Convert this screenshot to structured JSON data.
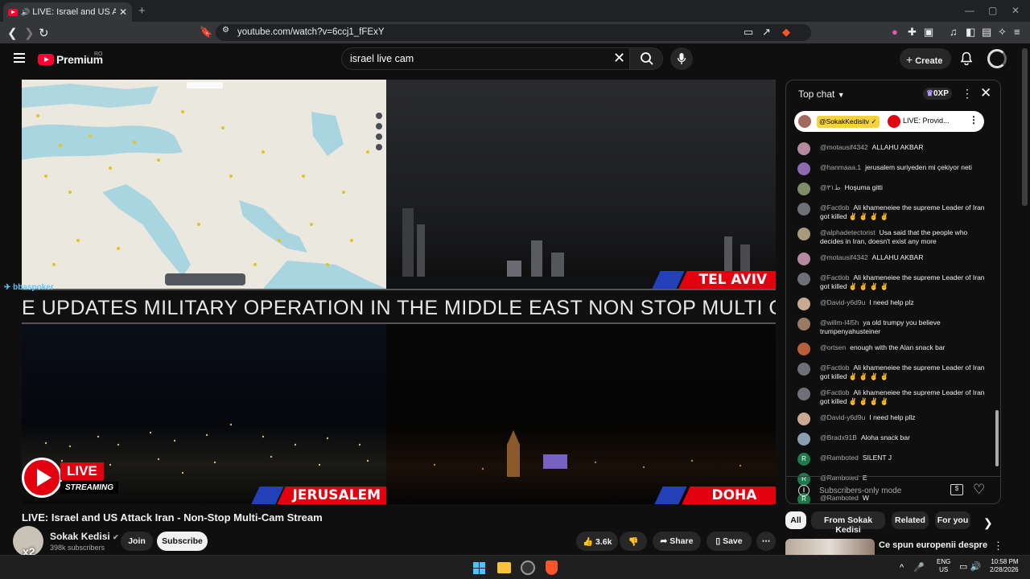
{
  "browser": {
    "tab_title": "LIVE: Israel and US Attack Iran",
    "new_tab": "+",
    "url": "youtube.com/watch?v=6ccj1_fFExY",
    "window_controls": [
      "—",
      "▢",
      "✕"
    ]
  },
  "youtube": {
    "logo_text": "Premium",
    "logo_region": "RO",
    "search_value": "israel live cam",
    "create_label": "Create"
  },
  "video": {
    "ticker_text": "E UPDATES MILITARY OPERATION IN THE MIDDLE EAST NON STOP MULTI CAM S",
    "cities": [
      "TEL AVIV",
      "JERUSALEM",
      "DOHA"
    ],
    "live_label": "LIVE",
    "streaming_label": "STREAMING",
    "handle_tag": "bbaspoker",
    "title": "LIVE: Israel and US Attack Iran - Non-Stop Multi-Cam Stream"
  },
  "channel": {
    "name": "Sokak Kedisi",
    "subscribers": "398k subscribers",
    "avatar_badge": "x2",
    "join_label": "Join",
    "subscribe_label": "Subscribe"
  },
  "actions": {
    "likes": "3.6k",
    "share_label": "Share",
    "save_label": "Save"
  },
  "chat": {
    "header": "Top chat",
    "xp": "0XP",
    "pinned_handle": "@SokakKedisitv",
    "pinned_text": "LIVE: Provid...",
    "messages": [
      {
        "user": "@motausif4342",
        "text": "ALLAHU AKBAR",
        "color": "#b58aa0"
      },
      {
        "user": "@hanmaaa.1",
        "text": "jerusalem suriyeden mi çekiyor neti",
        "color": "#8d6bb0"
      },
      {
        "user": "@ط٣١",
        "text": "Hoşuma gitti",
        "color": "#7f8c6a"
      },
      {
        "user": "@Factlob",
        "text": "Ali khameneiee the supreme Leader of Iran got killed ✌️ ✌️ ✌️ ✌️",
        "color": "#6f6f77"
      },
      {
        "user": "@alphadetectorist",
        "text": "Usa said that the people who decides in Iran, doesn't exist any more",
        "color": "#a89a7a"
      },
      {
        "user": "@motausif4342",
        "text": "ALLAHU AKBAR",
        "color": "#b58aa0"
      },
      {
        "user": "@Factlob",
        "text": "Ali khameneiee the supreme Leader of Iran got killed ✌️ ✌️ ✌️ ✌️",
        "color": "#6f6f77"
      },
      {
        "user": "@David-y6d9u",
        "text": "I need help plz",
        "color": "#c9a98f"
      },
      {
        "user": "@willm-l4l5h",
        "text": "ya old trumpy you believe trumpenyahusteiner",
        "color": "#9a7a63"
      },
      {
        "user": "@ortsen",
        "text": "enough with the Alan snack bar",
        "color": "#b5603a"
      },
      {
        "user": "@Factlob",
        "text": "Ali khameneiee the supreme Leader of Iran got killed ✌️ ✌️ ✌️ ✌️",
        "color": "#6f6f77"
      },
      {
        "user": "@Factlob",
        "text": "Ali khameneiee the supreme Leader of Iran got killed ✌️ ✌️ ✌️ ✌️",
        "color": "#6f6f77"
      },
      {
        "user": "@David-y6d9u",
        "text": "I need help pllz",
        "color": "#c9a98f"
      },
      {
        "user": "@Bradx91B",
        "text": "Aloha snack bar",
        "color": "#8aa0b0"
      },
      {
        "user": "@Ramboted",
        "text": "SILENT J",
        "color": "#1e7a4a",
        "initial": "R"
      },
      {
        "user": "@Ramboted",
        "text": "E",
        "color": "#1e7a4a",
        "initial": "R"
      },
      {
        "user": "@Ramboted",
        "text": "W",
        "color": "#1e7a4a",
        "initial": "R"
      }
    ],
    "footer": "Subscribers-only mode"
  },
  "related": {
    "chips": [
      "All",
      "From Sokak Kedisi",
      "Related",
      "For you"
    ],
    "first_title": "Ce spun europenii despre"
  },
  "taskbar": {
    "lang_line1": "ENG",
    "lang_line2": "US",
    "time": "10:58 PM",
    "date": "2/28/2026"
  }
}
